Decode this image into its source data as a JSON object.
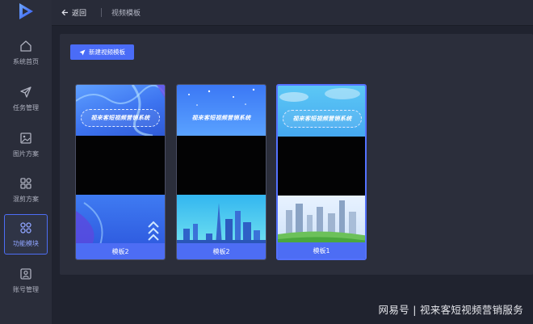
{
  "header": {
    "back_label": "返回",
    "title": "视频模板"
  },
  "sidebar": {
    "items": [
      {
        "label": "系统首页",
        "icon": "home-icon"
      },
      {
        "label": "任务管理",
        "icon": "send-icon"
      },
      {
        "label": "图片方案",
        "icon": "image-icon"
      },
      {
        "label": "混剪方案",
        "icon": "mix-icon"
      },
      {
        "label": "功能模块",
        "icon": "grid-icon",
        "active": true
      },
      {
        "label": "账号管理",
        "icon": "user-icon"
      }
    ]
  },
  "toolbar": {
    "new_template_label": "新建视频模板"
  },
  "templates": [
    {
      "caption": "模板2",
      "banner_text": "视来客短视频营销系统"
    },
    {
      "caption": "模板2",
      "banner_text": "视来客短视频营销系统"
    },
    {
      "caption": "模板1",
      "banner_text": "视来客短视频营销系统",
      "selected": true
    }
  ],
  "watermark": "网易号 | 视来客短视频营销服务",
  "colors": {
    "accent": "#4a6cf7",
    "sidebar_bg": "#2a2d3a",
    "page_bg": "#20232f",
    "panel_bg": "#2b2e3b"
  }
}
